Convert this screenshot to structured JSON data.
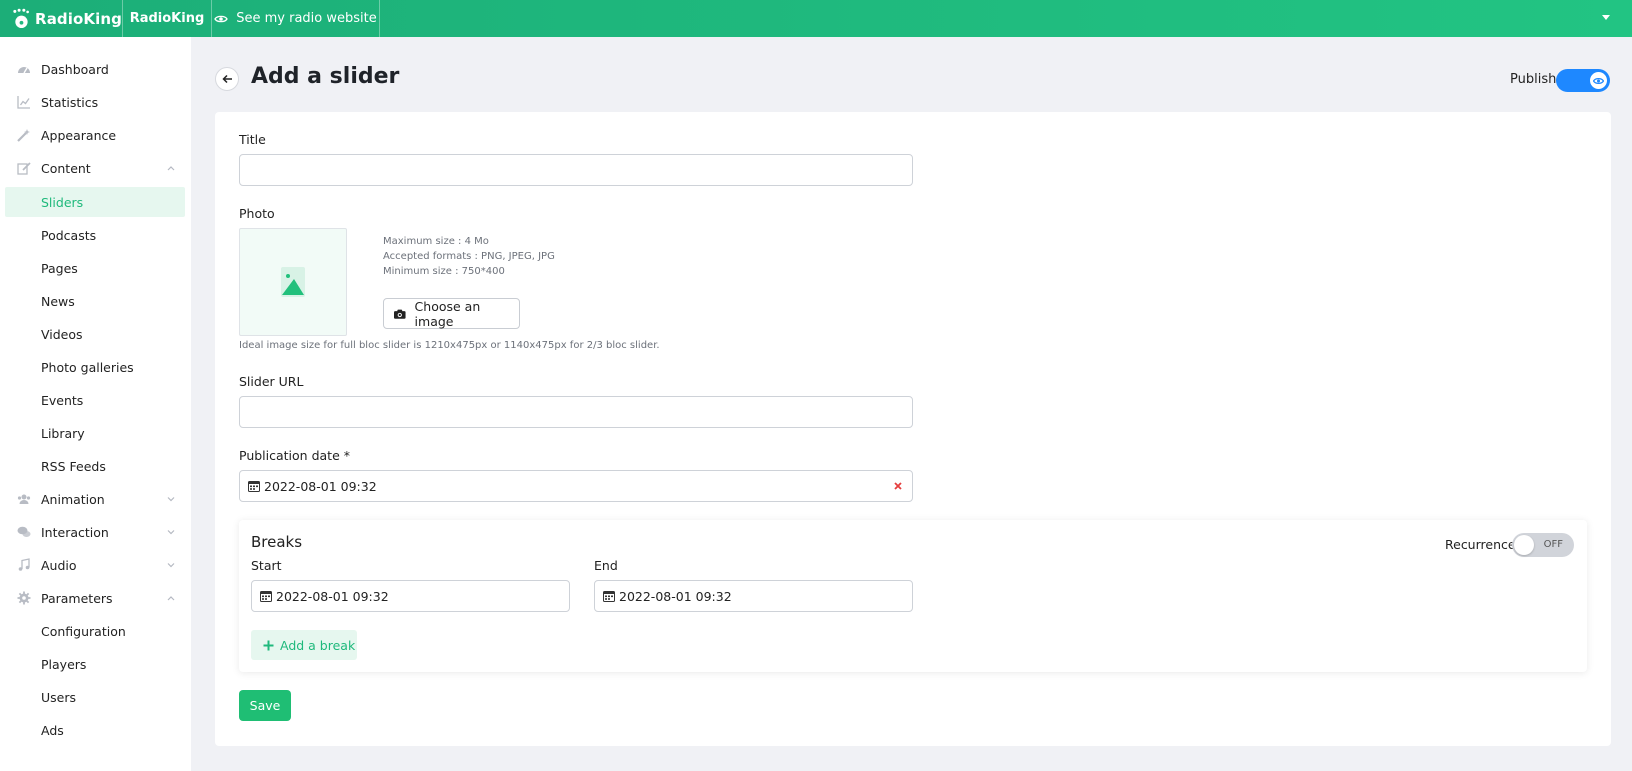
{
  "topbar": {
    "logo_text": "RadioKing",
    "radio_name": "RadioKing",
    "see_site_label": "See my radio website"
  },
  "sidebar": {
    "items": [
      {
        "label": "Dashboard",
        "icon": "dashboard-icon"
      },
      {
        "label": "Statistics",
        "icon": "chart-icon"
      },
      {
        "label": "Appearance",
        "icon": "magic-wand-icon"
      },
      {
        "label": "Content",
        "icon": "edit-icon",
        "expanded": true
      },
      {
        "label": "Sliders",
        "active": true
      },
      {
        "label": "Podcasts"
      },
      {
        "label": "Pages"
      },
      {
        "label": "News"
      },
      {
        "label": "Videos"
      },
      {
        "label": "Photo galleries"
      },
      {
        "label": "Events"
      },
      {
        "label": "Library"
      },
      {
        "label": "RSS Feeds"
      },
      {
        "label": "Animation",
        "icon": "users-icon",
        "expanded": false
      },
      {
        "label": "Interaction",
        "icon": "comments-icon",
        "expanded": false
      },
      {
        "label": "Audio",
        "icon": "music-icon",
        "expanded": false
      },
      {
        "label": "Parameters",
        "icon": "gear-icon",
        "expanded": true
      },
      {
        "label": "Configuration"
      },
      {
        "label": "Players"
      },
      {
        "label": "Users"
      },
      {
        "label": "Ads"
      }
    ]
  },
  "header": {
    "title": "Add a slider",
    "publish_label": "Publish",
    "publish_on": true
  },
  "form": {
    "title_label": "Title",
    "title_value": "",
    "photo_label": "Photo",
    "photo_info": [
      "Maximum size : 4 Mo",
      "Accepted formats : PNG, JPEG, JPG",
      "Minimum size : 750*400"
    ],
    "choose_image_label": "Choose an image",
    "ideal_size_note": "Ideal image size for full bloc slider is 1210x475px or 1140x475px for 2/3 bloc slider.",
    "slider_url_label": "Slider URL",
    "slider_url_value": "",
    "publication_date_label": "Publication date *",
    "publication_date_value": "2022-08-01 09:32"
  },
  "breaks": {
    "title": "Breaks",
    "recurrence_label": "Recurrence",
    "recurrence_state": "OFF",
    "start_label": "Start",
    "start_value": "2022-08-01 09:32",
    "end_label": "End",
    "end_value": "2022-08-01 09:32",
    "add_break_label": "Add a break"
  },
  "save_label": "Save",
  "colors": {
    "brand_green": "#1fbe74",
    "toggle_blue": "#1e88ff"
  }
}
